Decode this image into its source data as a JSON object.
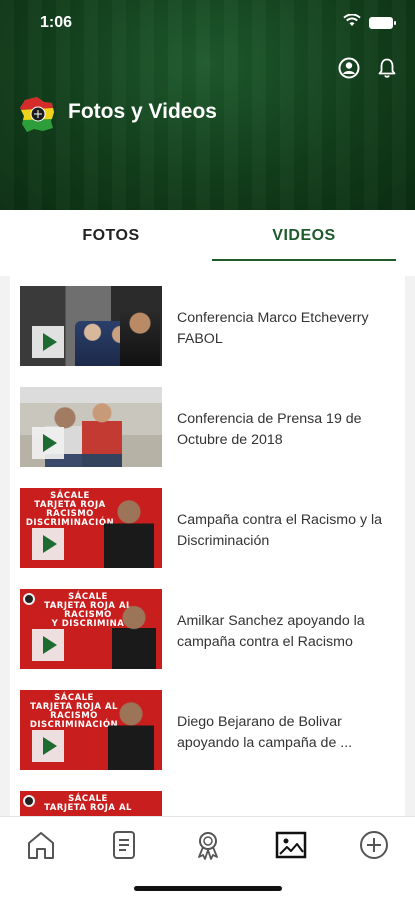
{
  "status_bar": {
    "time": "1:06"
  },
  "header": {
    "title": "Fotos y Videos"
  },
  "tabs": [
    {
      "label": "FOTOS",
      "active": false
    },
    {
      "label": "VIDEOS",
      "active": true
    }
  ],
  "videos": [
    {
      "title": "Conferencia Marco Etcheverry FABOL"
    },
    {
      "title": "Conferencia de Prensa 19 de Octubre de 2018"
    },
    {
      "title": "Campaña contra el Racismo y la Discriminación",
      "banner": "SÁCALE\nTARJETA ROJA\nRACISMO\nDISCRIMINACIÓN"
    },
    {
      "title": "Amilkar Sanchez apoyando la campaña contra el Racismo",
      "banner": "SÁCALE\nTARJETA ROJA AL\nRACISMO\nY DISCRIMINA"
    },
    {
      "title": "Diego Bejarano de Bolivar apoyando la campaña de ...",
      "banner": "SÁCALE\nTARJETA ROJA AL\nRACISMO\nDISCRIMINACIÓN"
    },
    {
      "title": "",
      "banner": "SÁCALE\nTARJETA ROJA AL"
    }
  ],
  "bottom_nav": [
    {
      "icon": "home-icon"
    },
    {
      "icon": "news-document-icon"
    },
    {
      "icon": "award-ribbon-icon"
    },
    {
      "icon": "gallery-image-icon",
      "active": true
    },
    {
      "icon": "plus-circle-icon"
    }
  ],
  "colors": {
    "brand_green": "#1d5b2c",
    "banner_red": "#c81e1e"
  }
}
